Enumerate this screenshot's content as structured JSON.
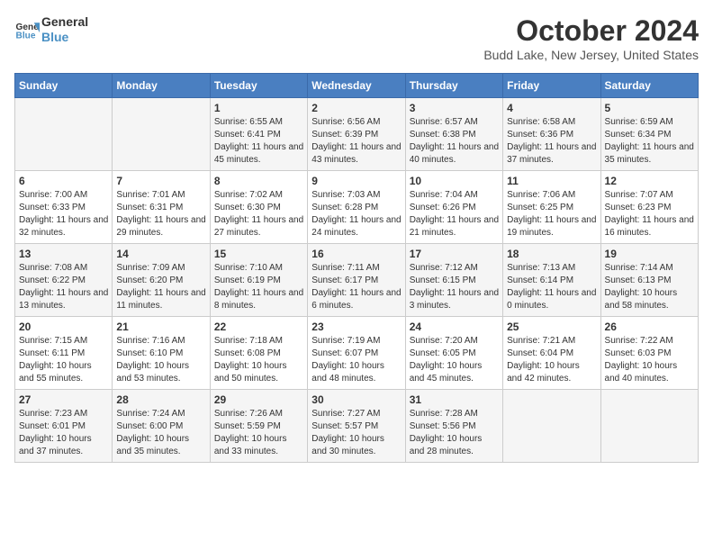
{
  "header": {
    "logo_line1": "General",
    "logo_line2": "Blue",
    "month": "October 2024",
    "location": "Budd Lake, New Jersey, United States"
  },
  "days_of_week": [
    "Sunday",
    "Monday",
    "Tuesday",
    "Wednesday",
    "Thursday",
    "Friday",
    "Saturday"
  ],
  "weeks": [
    [
      {
        "day": "",
        "info": ""
      },
      {
        "day": "",
        "info": ""
      },
      {
        "day": "1",
        "info": "Sunrise: 6:55 AM\nSunset: 6:41 PM\nDaylight: 11 hours and 45 minutes."
      },
      {
        "day": "2",
        "info": "Sunrise: 6:56 AM\nSunset: 6:39 PM\nDaylight: 11 hours and 43 minutes."
      },
      {
        "day": "3",
        "info": "Sunrise: 6:57 AM\nSunset: 6:38 PM\nDaylight: 11 hours and 40 minutes."
      },
      {
        "day": "4",
        "info": "Sunrise: 6:58 AM\nSunset: 6:36 PM\nDaylight: 11 hours and 37 minutes."
      },
      {
        "day": "5",
        "info": "Sunrise: 6:59 AM\nSunset: 6:34 PM\nDaylight: 11 hours and 35 minutes."
      }
    ],
    [
      {
        "day": "6",
        "info": "Sunrise: 7:00 AM\nSunset: 6:33 PM\nDaylight: 11 hours and 32 minutes."
      },
      {
        "day": "7",
        "info": "Sunrise: 7:01 AM\nSunset: 6:31 PM\nDaylight: 11 hours and 29 minutes."
      },
      {
        "day": "8",
        "info": "Sunrise: 7:02 AM\nSunset: 6:30 PM\nDaylight: 11 hours and 27 minutes."
      },
      {
        "day": "9",
        "info": "Sunrise: 7:03 AM\nSunset: 6:28 PM\nDaylight: 11 hours and 24 minutes."
      },
      {
        "day": "10",
        "info": "Sunrise: 7:04 AM\nSunset: 6:26 PM\nDaylight: 11 hours and 21 minutes."
      },
      {
        "day": "11",
        "info": "Sunrise: 7:06 AM\nSunset: 6:25 PM\nDaylight: 11 hours and 19 minutes."
      },
      {
        "day": "12",
        "info": "Sunrise: 7:07 AM\nSunset: 6:23 PM\nDaylight: 11 hours and 16 minutes."
      }
    ],
    [
      {
        "day": "13",
        "info": "Sunrise: 7:08 AM\nSunset: 6:22 PM\nDaylight: 11 hours and 13 minutes."
      },
      {
        "day": "14",
        "info": "Sunrise: 7:09 AM\nSunset: 6:20 PM\nDaylight: 11 hours and 11 minutes."
      },
      {
        "day": "15",
        "info": "Sunrise: 7:10 AM\nSunset: 6:19 PM\nDaylight: 11 hours and 8 minutes."
      },
      {
        "day": "16",
        "info": "Sunrise: 7:11 AM\nSunset: 6:17 PM\nDaylight: 11 hours and 6 minutes."
      },
      {
        "day": "17",
        "info": "Sunrise: 7:12 AM\nSunset: 6:15 PM\nDaylight: 11 hours and 3 minutes."
      },
      {
        "day": "18",
        "info": "Sunrise: 7:13 AM\nSunset: 6:14 PM\nDaylight: 11 hours and 0 minutes."
      },
      {
        "day": "19",
        "info": "Sunrise: 7:14 AM\nSunset: 6:13 PM\nDaylight: 10 hours and 58 minutes."
      }
    ],
    [
      {
        "day": "20",
        "info": "Sunrise: 7:15 AM\nSunset: 6:11 PM\nDaylight: 10 hours and 55 minutes."
      },
      {
        "day": "21",
        "info": "Sunrise: 7:16 AM\nSunset: 6:10 PM\nDaylight: 10 hours and 53 minutes."
      },
      {
        "day": "22",
        "info": "Sunrise: 7:18 AM\nSunset: 6:08 PM\nDaylight: 10 hours and 50 minutes."
      },
      {
        "day": "23",
        "info": "Sunrise: 7:19 AM\nSunset: 6:07 PM\nDaylight: 10 hours and 48 minutes."
      },
      {
        "day": "24",
        "info": "Sunrise: 7:20 AM\nSunset: 6:05 PM\nDaylight: 10 hours and 45 minutes."
      },
      {
        "day": "25",
        "info": "Sunrise: 7:21 AM\nSunset: 6:04 PM\nDaylight: 10 hours and 42 minutes."
      },
      {
        "day": "26",
        "info": "Sunrise: 7:22 AM\nSunset: 6:03 PM\nDaylight: 10 hours and 40 minutes."
      }
    ],
    [
      {
        "day": "27",
        "info": "Sunrise: 7:23 AM\nSunset: 6:01 PM\nDaylight: 10 hours and 37 minutes."
      },
      {
        "day": "28",
        "info": "Sunrise: 7:24 AM\nSunset: 6:00 PM\nDaylight: 10 hours and 35 minutes."
      },
      {
        "day": "29",
        "info": "Sunrise: 7:26 AM\nSunset: 5:59 PM\nDaylight: 10 hours and 33 minutes."
      },
      {
        "day": "30",
        "info": "Sunrise: 7:27 AM\nSunset: 5:57 PM\nDaylight: 10 hours and 30 minutes."
      },
      {
        "day": "31",
        "info": "Sunrise: 7:28 AM\nSunset: 5:56 PM\nDaylight: 10 hours and 28 minutes."
      },
      {
        "day": "",
        "info": ""
      },
      {
        "day": "",
        "info": ""
      }
    ]
  ]
}
